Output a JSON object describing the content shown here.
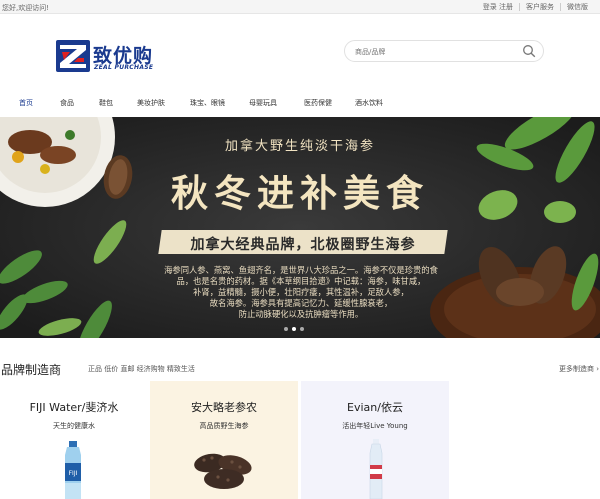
{
  "topbar": {
    "welcome": "您好,欢迎访问!",
    "login": "登录",
    "register": "注册",
    "service": "客户服务",
    "wechat": "微信版"
  },
  "logo": {
    "name": "致优购",
    "sub": "ZEAL PURCHASE"
  },
  "search": {
    "placeholder": "商品/品牌"
  },
  "nav": [
    "首页",
    "食品",
    "鞋包",
    "美妆护肤",
    "珠宝、眼镜",
    "母婴玩具",
    "医药保健",
    "酒水饮料"
  ],
  "banner": {
    "title": "加拿大野生纯淡干海参",
    "headline": "秋冬进补美食",
    "ribbon": "加拿大经典品牌，北极圈野生海参",
    "desc": [
      "海参同人参、燕窝、鱼翅齐名，是世界八大珍品之一。海参不仅是珍贵的食",
      "品，也是名贵的药材。据《本草纲目拾遗》中记载：海参，味甘咸，",
      "补肾，益精髓，摄小便，壮阳疗痿，其性温补，足敌人参，",
      "故名海参。海参具有提高记忆力、延缓性腺衰老，",
      "防止动脉硬化以及抗肿瘤等作用。"
    ],
    "slides": 3,
    "active_slide": 1
  },
  "section": {
    "title": "品牌制造商",
    "tags": "正品 低价 直邮 经济购物 精致生活",
    "more": "更多制造商 ›"
  },
  "cards": [
    {
      "title": "FIJI Water/斐济水",
      "subtitle": "天生的健康水",
      "bg": "#ffffff"
    },
    {
      "title": "安大略老参农",
      "subtitle": "高品质野生海参",
      "bg": "#fbf3e2"
    },
    {
      "title": "Evian/依云",
      "subtitle": "活出年轻Live Young",
      "bg": "#f3f3fb"
    },
    {
      "title": "",
      "subtitle": "",
      "bg": "#ffffff"
    }
  ],
  "colors": {
    "brand_blue": "#1a3a8f",
    "brand_red": "#e02020"
  }
}
